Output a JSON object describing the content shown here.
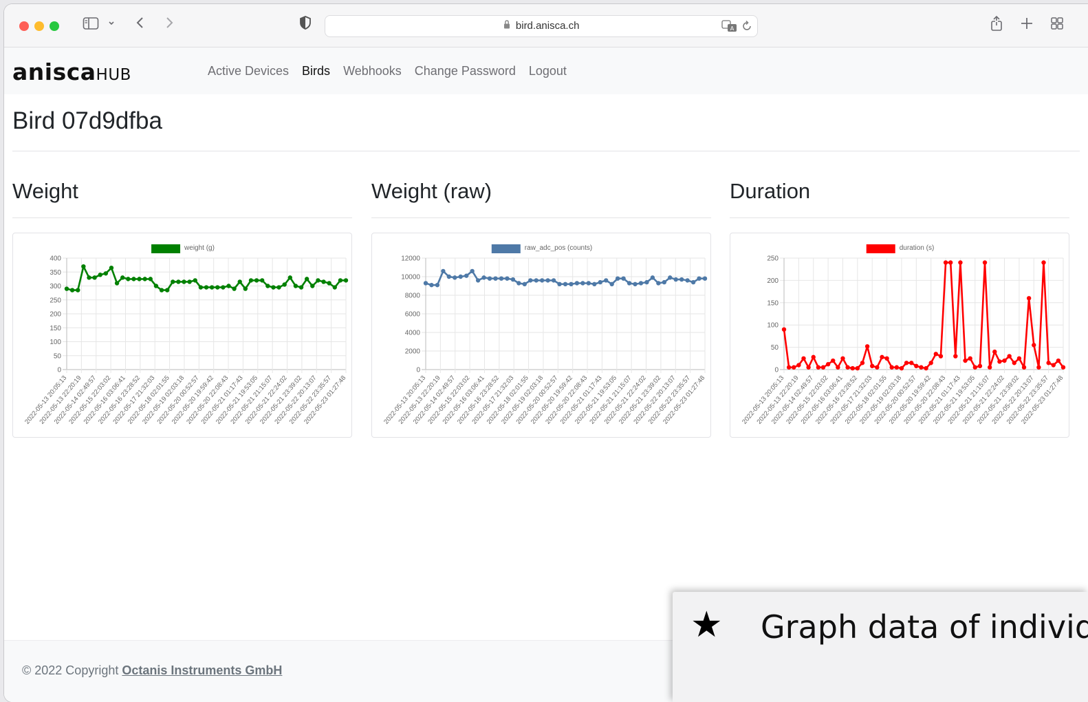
{
  "browser": {
    "url": "bird.anisca.ch",
    "icons": [
      "sidebar-icon",
      "chevron-down-icon",
      "back-icon",
      "forward-icon",
      "shield-icon",
      "lock-icon",
      "translate-icon",
      "reload-icon",
      "share-icon",
      "new-tab-icon",
      "tab-overview-icon"
    ]
  },
  "navbar": {
    "brand_main": "anisca",
    "brand_sub": "HUB",
    "links": [
      "Active Devices",
      "Birds",
      "Webhooks",
      "Change Password",
      "Logout"
    ],
    "active_link": "Birds"
  },
  "page": {
    "title": "Bird 07d9dfba"
  },
  "sections": {
    "weight": "Weight",
    "weight_raw": "Weight (raw)",
    "duration": "Duration"
  },
  "chart_data": [
    {
      "type": "line",
      "title": "",
      "legend": "weight (g)",
      "color": "#008000",
      "ylim": [
        0,
        400
      ],
      "yticks": [
        0,
        50,
        100,
        150,
        200,
        250,
        300,
        350,
        400
      ],
      "xtick_labels": [
        "2022-05-13 20:05:13",
        "2022-05-13 22:20:19",
        "2022-05-14 02:49:57",
        "2022-05-15 22:03:02",
        "2022-05-16 03:06:41",
        "2022-05-16 23:28:52",
        "2022-05-17 21:32:03",
        "2022-05-18 02:01:55",
        "2022-05-19 02:03:18",
        "2022-05-20 00:52:57",
        "2022-05-20 19:59:42",
        "2022-05-20 22:08:43",
        "2022-05-21 01:17:43",
        "2022-05-21 19:53:05",
        "2022-05-21 21:15:07",
        "2022-05-21 22:24:02",
        "2022-05-21 23:39:02",
        "2022-05-22 20:13:07",
        "2022-05-22 23:35:57",
        "2022-05-23 01:27:48"
      ],
      "values": [
        290,
        285,
        285,
        370,
        330,
        330,
        340,
        345,
        365,
        310,
        330,
        325,
        325,
        325,
        325,
        325,
        300,
        285,
        285,
        315,
        315,
        315,
        315,
        320,
        295,
        295,
        295,
        295,
        295,
        300,
        290,
        315,
        290,
        320,
        320,
        320,
        300,
        295,
        295,
        305,
        330,
        300,
        295,
        325,
        300,
        320,
        315,
        310,
        295,
        320,
        320
      ]
    },
    {
      "type": "line",
      "title": "",
      "legend": "raw_adc_pos (counts)",
      "color": "#4e79a7",
      "ylim": [
        0,
        12000
      ],
      "yticks": [
        0,
        2000,
        4000,
        6000,
        8000,
        10000,
        12000
      ],
      "xtick_labels": [
        "2022-05-13 20:05:13",
        "2022-05-13 22:20:19",
        "2022-05-14 02:49:57",
        "2022-05-15 22:03:02",
        "2022-05-16 03:06:41",
        "2022-05-16 23:28:52",
        "2022-05-17 21:32:03",
        "2022-05-18 02:01:55",
        "2022-05-19 02:03:18",
        "2022-05-20 00:52:57",
        "2022-05-20 19:59:42",
        "2022-05-20 22:08:43",
        "2022-05-21 01:17:43",
        "2022-05-21 19:53:05",
        "2022-05-21 21:15:07",
        "2022-05-21 22:24:02",
        "2022-05-21 23:39:02",
        "2022-05-22 20:13:07",
        "2022-05-22 23:35:57",
        "2022-05-23 01:27:48"
      ],
      "values": [
        9300,
        9100,
        9100,
        10600,
        10000,
        9900,
        10000,
        10100,
        10600,
        9600,
        9900,
        9800,
        9800,
        9800,
        9800,
        9700,
        9300,
        9200,
        9600,
        9600,
        9600,
        9600,
        9600,
        9200,
        9200,
        9200,
        9300,
        9300,
        9300,
        9200,
        9400,
        9600,
        9200,
        9800,
        9800,
        9300,
        9200,
        9300,
        9400,
        9900,
        9300,
        9400,
        9900,
        9700,
        9700,
        9600,
        9400,
        9800,
        9800
      ]
    },
    {
      "type": "line",
      "title": "",
      "legend": "duration (s)",
      "color": "#ff0000",
      "ylim": [
        0,
        250
      ],
      "yticks": [
        0,
        50,
        100,
        150,
        200,
        250
      ],
      "xtick_labels": [
        "2022-05-13 20:05:13",
        "2022-05-13 22:20:19",
        "2022-05-14 02:49:57",
        "2022-05-15 22:03:02",
        "2022-05-16 03:06:41",
        "2022-05-16 23:28:52",
        "2022-05-17 21:32:03",
        "2022-05-18 02:01:55",
        "2022-05-19 02:03:18",
        "2022-05-20 00:52:57",
        "2022-05-20 19:59:42",
        "2022-05-20 22:08:43",
        "2022-05-21 01:17:43",
        "2022-05-21 19:53:05",
        "2022-05-21 21:15:07",
        "2022-05-21 22:24:02",
        "2022-05-21 23:39:02",
        "2022-05-22 20:13:07",
        "2022-05-22 23:35:57",
        "2022-05-23 01:27:48"
      ],
      "values": [
        90,
        5,
        5,
        10,
        25,
        5,
        28,
        5,
        5,
        12,
        20,
        5,
        25,
        5,
        3,
        3,
        15,
        52,
        8,
        5,
        28,
        25,
        5,
        5,
        3,
        15,
        15,
        8,
        5,
        3,
        15,
        35,
        30,
        240,
        240,
        30,
        240,
        20,
        25,
        5,
        8,
        240,
        5,
        40,
        18,
        20,
        30,
        15,
        25,
        5,
        160,
        55,
        5,
        240,
        15,
        10,
        20,
        5
      ]
    }
  ],
  "footer": {
    "prefix": "© 2022 Copyright ",
    "link": "Octanis Instruments GmbH"
  },
  "overlay": {
    "star": "★",
    "text": "Graph data of individu"
  }
}
